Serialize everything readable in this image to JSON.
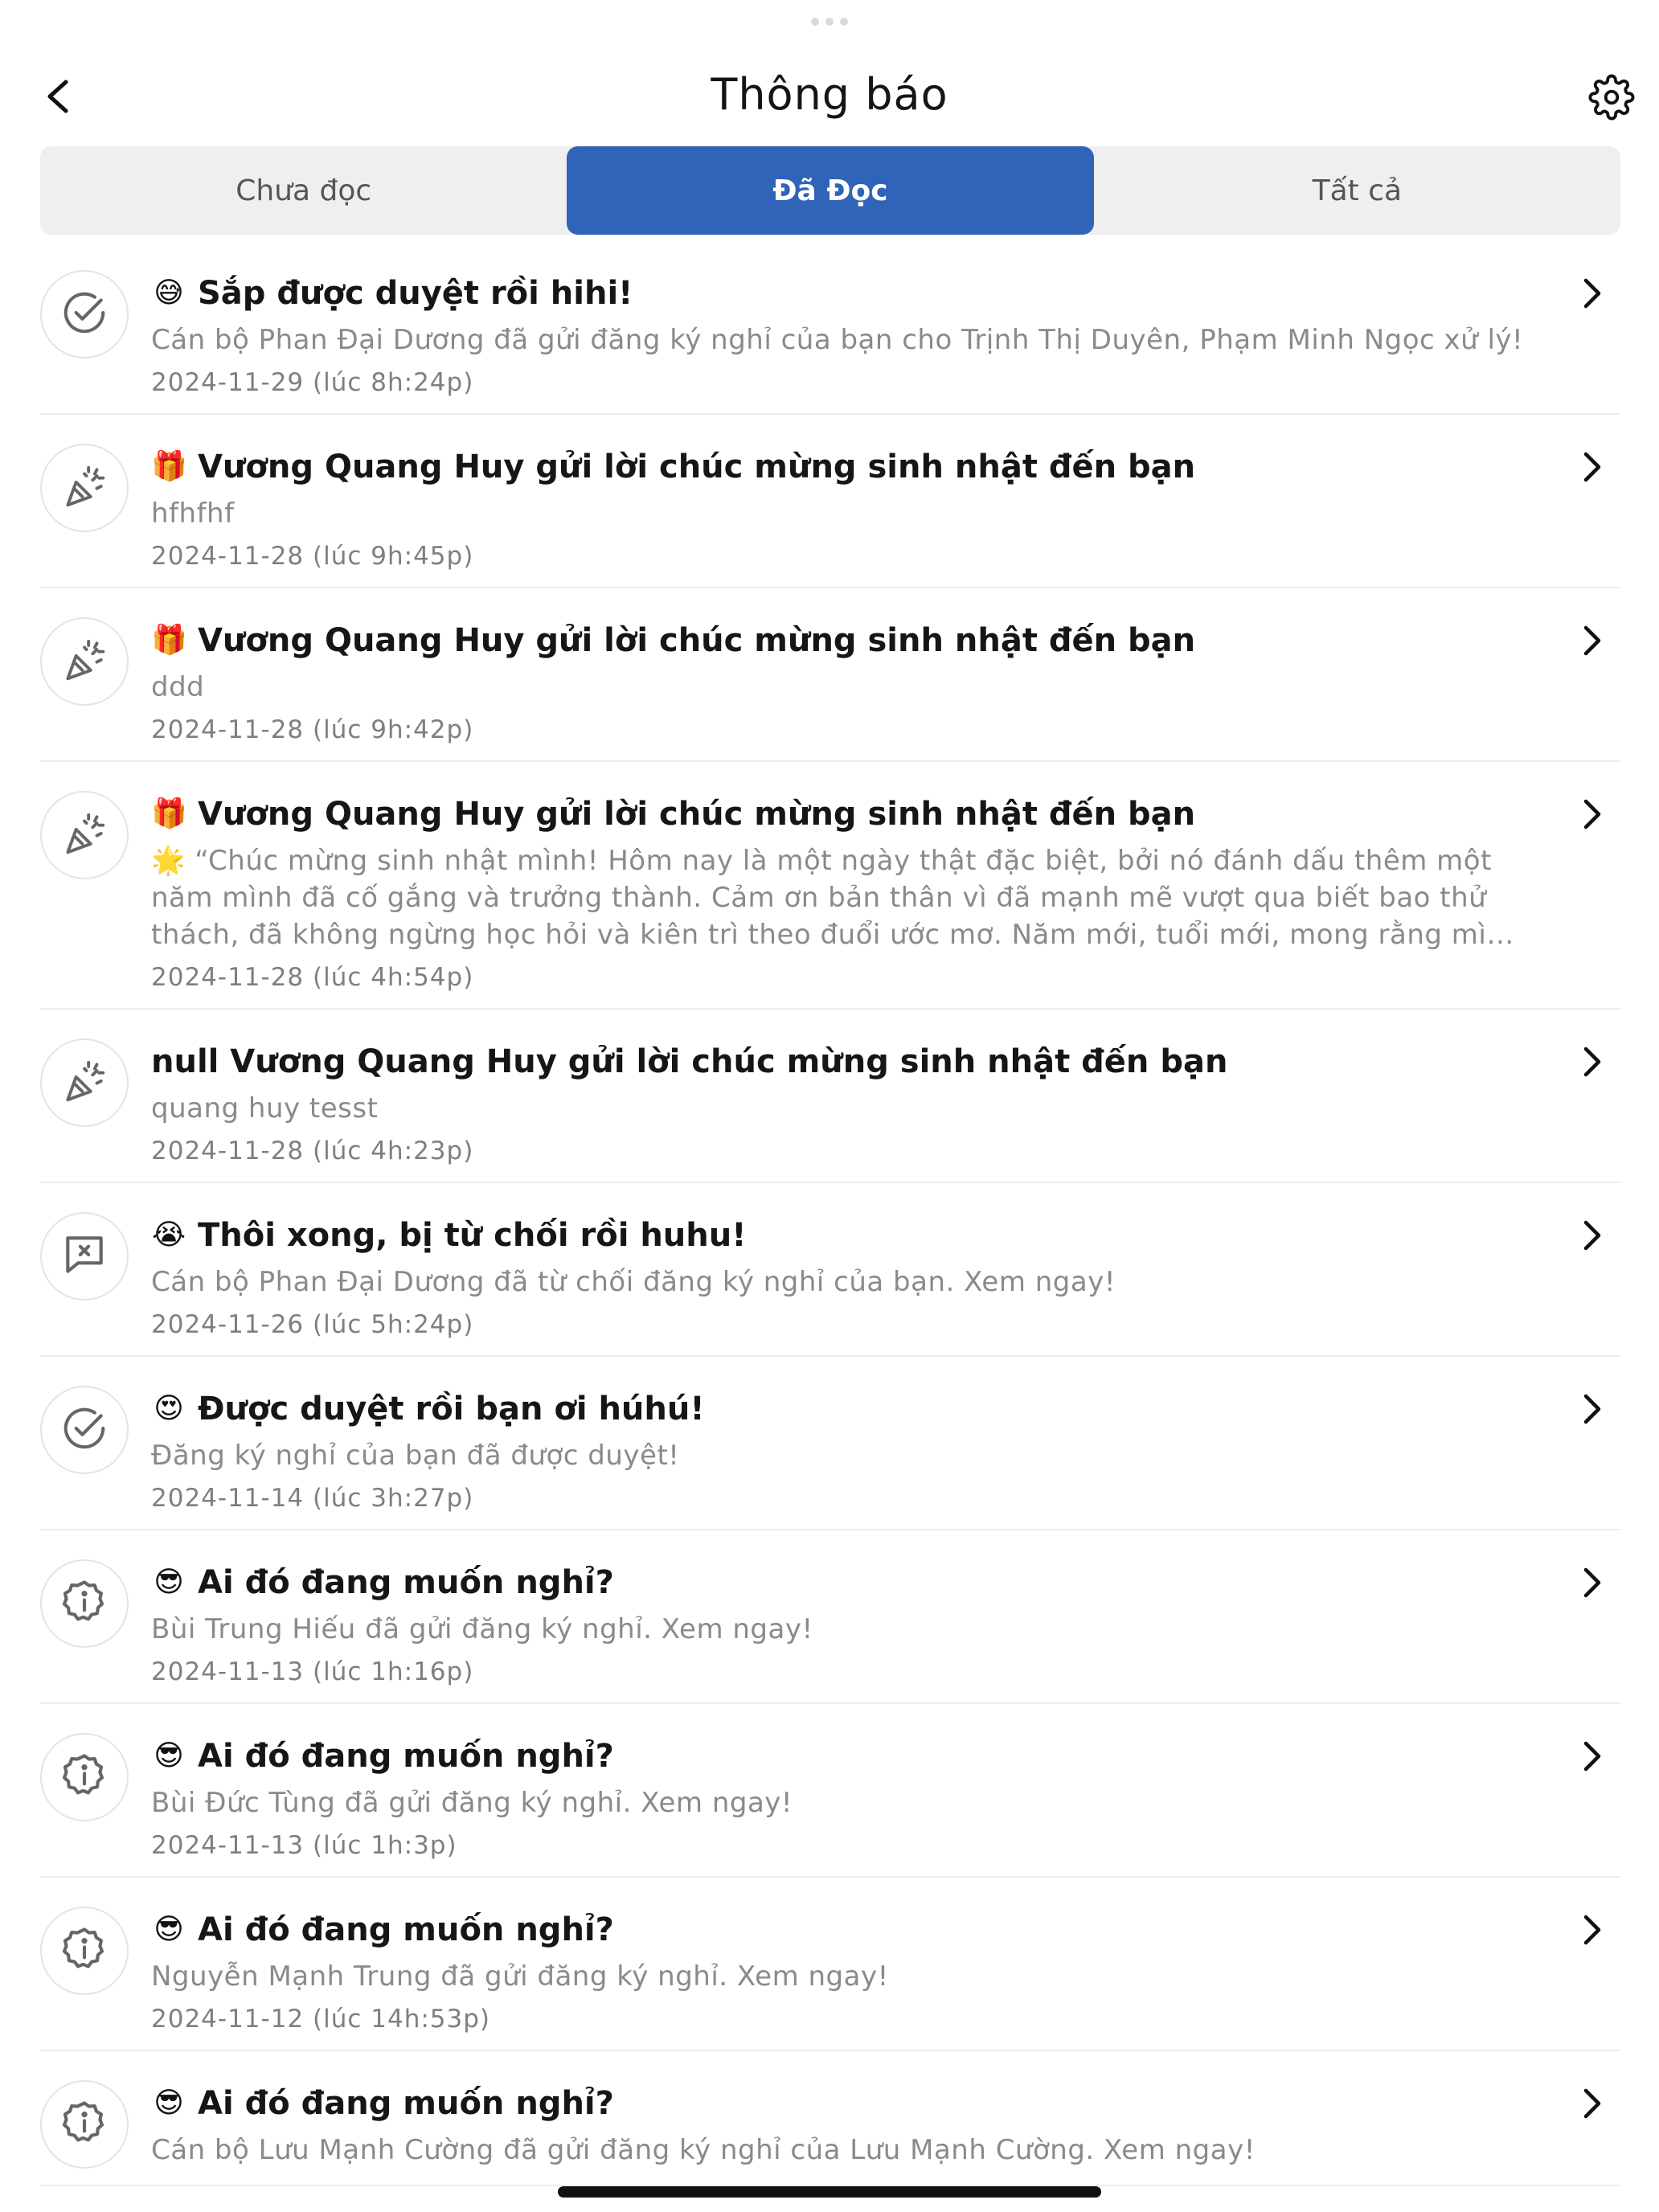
{
  "header": {
    "title": "Thông báo",
    "back_icon": "chevron-left-icon",
    "settings_icon": "gear-icon"
  },
  "tabs": [
    {
      "label": "Chưa đọc",
      "active": false
    },
    {
      "label": "Đã Đọc",
      "active": true
    },
    {
      "label": "Tất cả",
      "active": false
    }
  ],
  "colors": {
    "accent": "#2f64b8",
    "muted_text": "#8a8a8a",
    "tab_bg": "#efefef"
  },
  "notifications": [
    {
      "icon": "check-circle-icon",
      "emoji": "😅",
      "title": "Sắp được duyệt rồi hihi!",
      "body": "Cán bộ Phan Đại Dương đã gửi đăng ký nghỉ của bạn cho Trịnh Thị Duyên, Phạm Minh Ngọc xử lý!",
      "time": "2024-11-29 (lúc 8h:24p)"
    },
    {
      "icon": "party-popper-icon",
      "emoji": "🎁",
      "title": "Vương Quang Huy gửi lời chúc mừng sinh nhật đến bạn",
      "body": "hfhfhf",
      "time": "2024-11-28 (lúc 9h:45p)"
    },
    {
      "icon": "party-popper-icon",
      "emoji": "🎁",
      "title": "Vương Quang Huy gửi lời chúc mừng sinh nhật đến bạn",
      "body": "ddd",
      "time": "2024-11-28 (lúc 9h:42p)"
    },
    {
      "icon": "party-popper-icon",
      "emoji": "🎁",
      "title": "Vương Quang Huy gửi lời chúc mừng sinh nhật đến bạn",
      "body": "🌟 “Chúc mừng sinh nhật mình! Hôm nay là một ngày thật đặc biệt, bởi nó đánh dấu thêm một năm mình đã cố gắng và trưởng thành. Cảm ơn bản thân vì đã mạnh mẽ vượt qua biết bao thử thách, đã không ngừng học hỏi và kiên trì theo đuổi ước mơ. Năm mới, tuổi mới, mong rằng mình sẽ luôn sống tích cực, y...",
      "time": "2024-11-28 (lúc 4h:54p)"
    },
    {
      "icon": "party-popper-icon",
      "emoji": "",
      "title": "null Vương Quang Huy gửi lời chúc mừng sinh nhật đến bạn",
      "body": "quang huy tesst",
      "time": "2024-11-28 (lúc 4h:23p)"
    },
    {
      "icon": "message-x-icon",
      "emoji": "😭",
      "title": "Thôi xong, bị từ chối rồi huhu!",
      "body": "Cán bộ Phan Đại Dương đã từ chối đăng ký nghỉ của bạn. Xem ngay!",
      "time": "2024-11-26 (lúc 5h:24p)"
    },
    {
      "icon": "check-circle-icon",
      "emoji": "😍",
      "title": "Được duyệt rồi bạn ơi húhú!",
      "body": "Đăng ký nghỉ của bạn đã được duyệt!",
      "time": "2024-11-14 (lúc 3h:27p)"
    },
    {
      "icon": "info-badge-icon",
      "emoji": "😎",
      "title": "Ai đó đang muốn nghỉ?",
      "body": "Bùi Trung Hiếu đã gửi đăng ký nghỉ. Xem ngay!",
      "time": "2024-11-13 (lúc 1h:16p)"
    },
    {
      "icon": "info-badge-icon",
      "emoji": "😎",
      "title": "Ai đó đang muốn nghỉ?",
      "body": "Bùi Đức Tùng đã gửi đăng ký nghỉ. Xem ngay!",
      "time": "2024-11-13 (lúc 1h:3p)"
    },
    {
      "icon": "info-badge-icon",
      "emoji": "😎",
      "title": "Ai đó đang muốn nghỉ?",
      "body": "Nguyễn Mạnh Trung đã gửi đăng ký nghỉ. Xem ngay!",
      "time": "2024-11-12 (lúc 14h:53p)"
    },
    {
      "icon": "info-badge-icon",
      "emoji": "😎",
      "title": "Ai đó đang muốn nghỉ?",
      "body": "Cán bộ Lưu Mạnh Cường đã gửi đăng ký nghỉ của Lưu Mạnh Cường. Xem ngay!",
      "time": ""
    }
  ]
}
